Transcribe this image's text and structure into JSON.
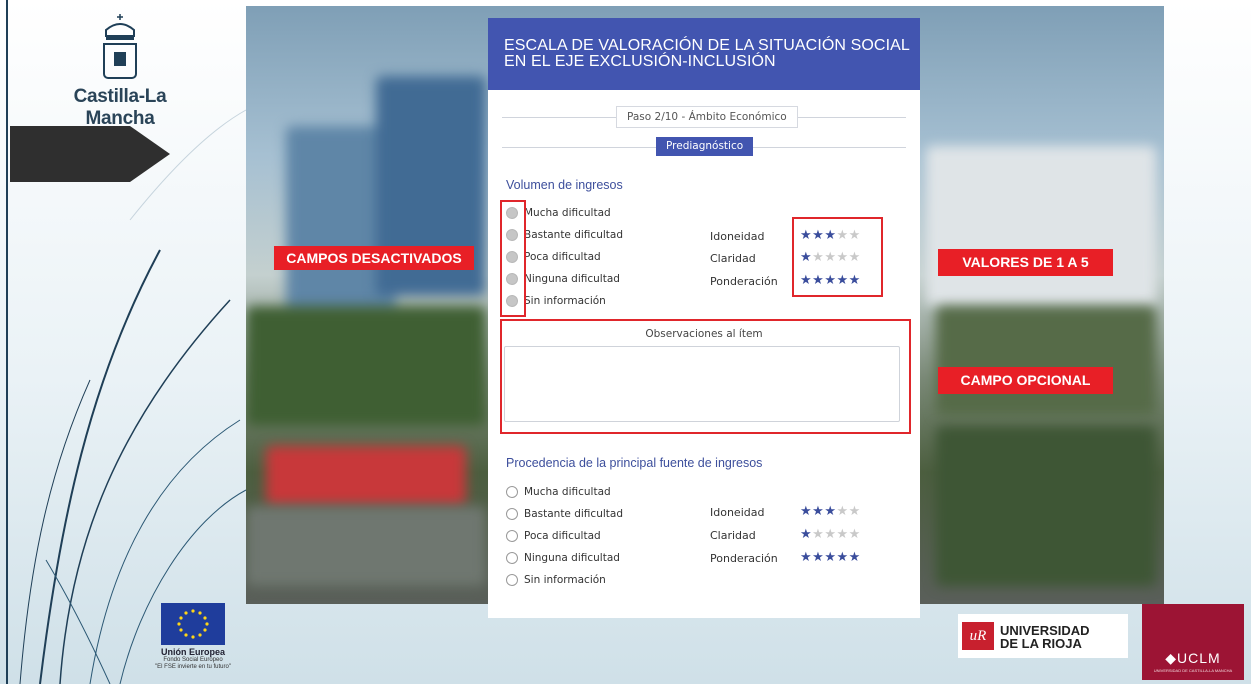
{
  "branding": {
    "jccm_name": "Castilla-La Mancha",
    "eu_title": "Unión Europea",
    "eu_fund": "Fondo Social Europeo",
    "eu_motto": "\"El FSE invierte en tu futuro\"",
    "ur_line1": "UNIVERSIDAD",
    "ur_line2": "DE LA RIOJA",
    "uclm_name": "◆UCLM",
    "uclm_sub": "UNIVERSIDAD DE CASTILLA-LA MANCHA"
  },
  "form": {
    "title_line1": "ESCALA DE VALORACIÓN DE LA SITUACIÓN SOCIAL",
    "title_line2": "EN EL EJE EXCLUSIÓN-INCLUSIÓN",
    "step": "Paso 2/10 - Ámbito Económico",
    "badge": "Prediagnóstico",
    "observations_label": "Observaciones al ítem",
    "observations_value": "",
    "items": [
      {
        "title": "Volumen de ingresos",
        "disabled": true,
        "options": [
          "Mucha dificultad",
          "Bastante dificultad",
          "Poca dificultad",
          "Ninguna dificultad",
          "Sin información"
        ],
        "ratings": [
          {
            "label": "Idoneidad",
            "value": 3,
            "max": 5
          },
          {
            "label": "Claridad",
            "value": 1,
            "max": 5
          },
          {
            "label": "Ponderación",
            "value": 5,
            "max": 5
          }
        ]
      },
      {
        "title": "Procedencia de la principal fuente de ingresos",
        "disabled": false,
        "options": [
          "Mucha dificultad",
          "Bastante dificultad",
          "Poca dificultad",
          "Ninguna dificultad",
          "Sin información"
        ],
        "ratings": [
          {
            "label": "Idoneidad",
            "value": 3,
            "max": 5
          },
          {
            "label": "Claridad",
            "value": 1,
            "max": 5
          },
          {
            "label": "Ponderación",
            "value": 5,
            "max": 5
          }
        ]
      }
    ]
  },
  "annotations": {
    "disabled_fields": "CAMPOS DESACTIVADOS",
    "values_range": "VALORES DE 1 A 5",
    "optional_field": "CAMPO OPCIONAL"
  },
  "colors": {
    "form_header": "#4255b0",
    "star_active": "#3a4d9c",
    "star_inactive": "#c9c9c9",
    "annotation_red": "#e81f26",
    "uclm": "#9c1434"
  }
}
